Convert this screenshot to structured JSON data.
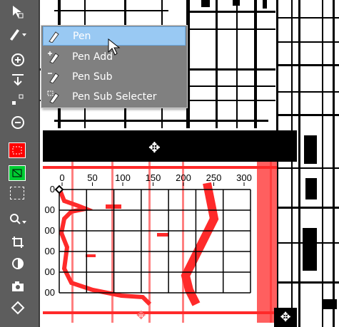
{
  "menu": {
    "items": [
      {
        "label": "Pen",
        "icon": "pen-icon",
        "selected": true
      },
      {
        "label": "Pen Add",
        "icon": "pen-add-icon",
        "selected": false
      },
      {
        "label": "Pen Sub",
        "icon": "pen-sub-icon",
        "selected": false
      },
      {
        "label": "Pen Sub Selecter",
        "icon": "pen-sub-selecter-icon",
        "selected": false
      }
    ]
  },
  "toolbar": {
    "tools": [
      "select-arrow-icon",
      "pen-dropdown-icon",
      "zoom-in-icon",
      "arrow-down-to-line-icon",
      "point-icon",
      "zoom-out-icon",
      "red-select-icon",
      "green-select-icon",
      "dashed-select-icon",
      "magnifier-dropdown-icon",
      "crop-icon",
      "contrast-icon",
      "camera-icon",
      "diamond-icon"
    ]
  },
  "grid": {
    "x_ticks": [
      "0",
      "50",
      "100",
      "150",
      "200",
      "250",
      "300"
    ],
    "y_ticks": [
      "0",
      "00",
      "00",
      "00",
      "00",
      "00"
    ]
  },
  "colors": {
    "accent": "#99c9f3",
    "toolbar": "#5d5d5d",
    "menu": "#808080",
    "trace": "#ff0000"
  }
}
